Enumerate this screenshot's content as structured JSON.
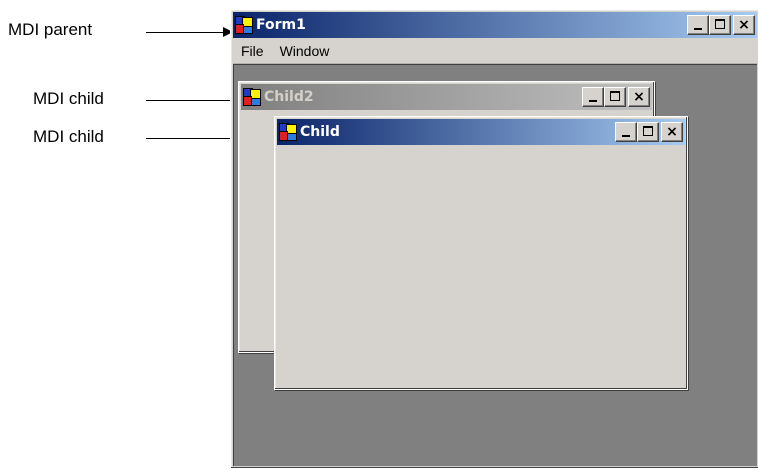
{
  "callouts": {
    "parent": "MDI parent",
    "child_a": "MDI child",
    "child_b": "MDI child"
  },
  "parent_window": {
    "title": "Form1",
    "menu": [
      "File",
      "Window"
    ]
  },
  "child2_window": {
    "title": "Child2",
    "state": "inactive"
  },
  "child_window": {
    "title": "Child",
    "state": "active"
  },
  "caption_buttons": {
    "minimize": "minimize-icon",
    "maximize": "maximize-icon",
    "close": "×"
  },
  "colors": {
    "active_title_start": "#0a246a",
    "active_title_end": "#a6caf0",
    "inactive_title_start": "#808080",
    "inactive_title_end": "#c0c0c0",
    "window_face": "#d6d3ce",
    "mdi_background": "#808080"
  }
}
